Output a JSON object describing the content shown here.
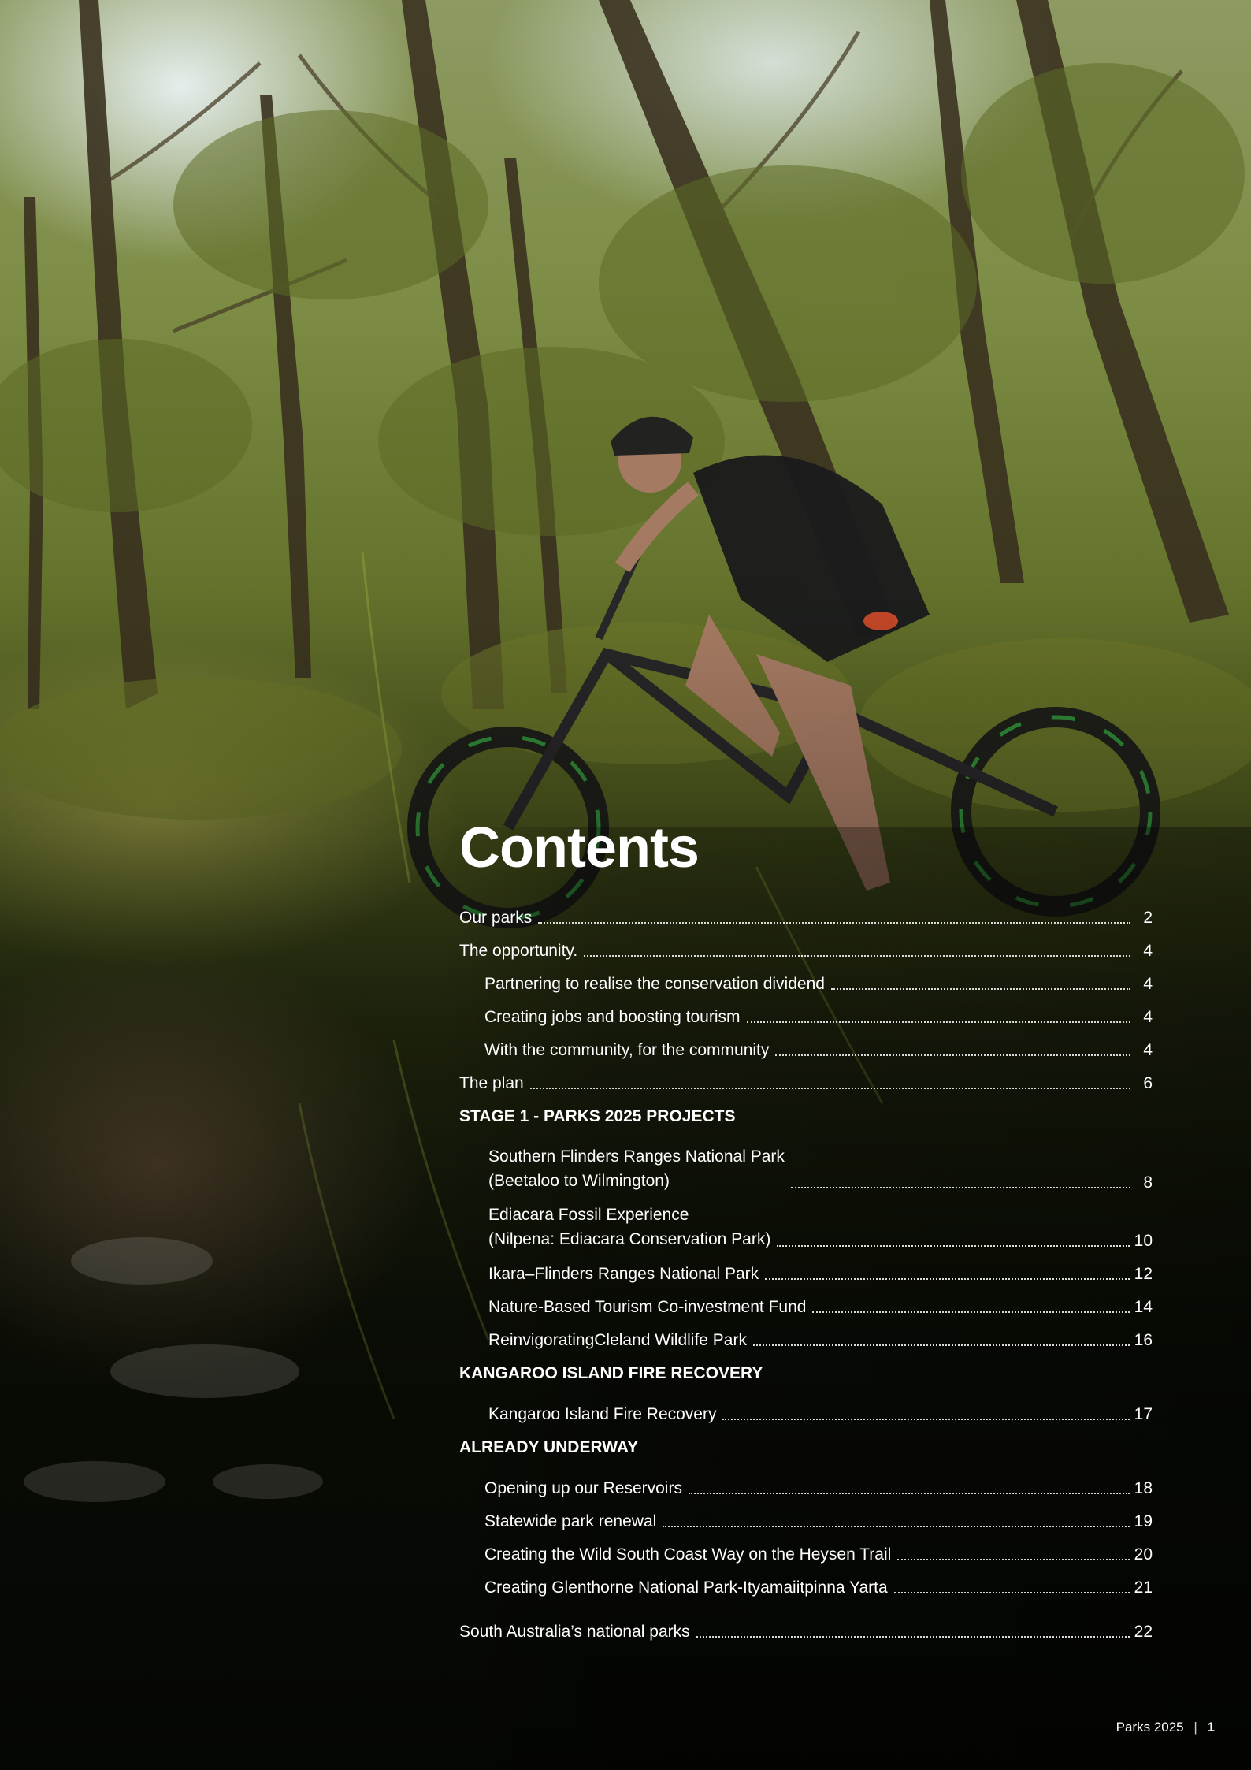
{
  "contents": {
    "title": "Contents",
    "top_items": [
      {
        "label": "Our parks",
        "page": "2"
      },
      {
        "label": "The opportunity.",
        "page": "4"
      }
    ],
    "opportunity_subitems": [
      {
        "label": "Partnering to realise the conservation dividend",
        "page": "4"
      },
      {
        "label": "Creating jobs and boosting tourism",
        "page": "4"
      },
      {
        "label": "With the community, for the community",
        "page": "4"
      }
    ],
    "plan_item": {
      "label": "The plan",
      "page": "6"
    },
    "stage1": {
      "heading": "STAGE 1 - PARKS 2025 PROJECTS",
      "items": [
        {
          "line1": "Southern Flinders Ranges National Park",
          "line2": "(Beetaloo to Wilmington)",
          "page": "8"
        },
        {
          "line1": "Ediacara Fossil Experience",
          "line2": "(Nilpena: Ediacara Conservation Park)",
          "page": "10"
        },
        {
          "label": "Ikara–Flinders Ranges National Park",
          "page": "12"
        },
        {
          "label": "Nature-Based Tourism Co-investment Fund",
          "page": "14"
        },
        {
          "label": "ReinvigoratingCleland Wildlife Park",
          "page": "16"
        }
      ]
    },
    "kangaroo": {
      "heading": "KANGAROO ISLAND FIRE RECOVERY",
      "items": [
        {
          "label": "Kangaroo Island Fire Recovery",
          "page": "17"
        }
      ]
    },
    "underway": {
      "heading": "ALREADY UNDERWAY",
      "items": [
        {
          "label": "Opening up our Reservoirs",
          "page": "18"
        },
        {
          "label": "Statewide park renewal",
          "page": "19"
        },
        {
          "label": "Creating the Wild South Coast Way on the Heysen Trail",
          "page": "20"
        },
        {
          "label": "Creating Glenthorne National Park-Ityamaiitpinna Yarta",
          "page": "21"
        }
      ]
    },
    "final_item": {
      "label": "South Australia’s national parks",
      "page": "22"
    }
  },
  "footer": {
    "doc_name": "Parks 2025",
    "separator": "|",
    "page_number": "1"
  },
  "colors": {
    "text": "#ffffff",
    "background_dark": "#1a1d10",
    "foliage": "#6b7a30"
  }
}
